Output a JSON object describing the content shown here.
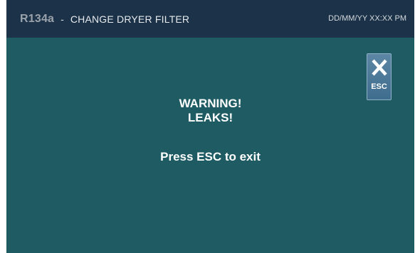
{
  "header": {
    "brand": "R134a",
    "separator": "-",
    "title": "CHANGE DRYER FILTER",
    "datetime": "DD/MM/YY XX:XX PM"
  },
  "esc_button": {
    "icon": "close-icon",
    "label": "ESC"
  },
  "message": {
    "line1": "WARNING!",
    "line2": "LEAKS!",
    "line3": "Press ESC to exit"
  },
  "colors": {
    "header_bg": "#1b3248",
    "screen_bg": "#1e5b62",
    "button_bg": "#4a7899",
    "text": "#ffffff"
  }
}
